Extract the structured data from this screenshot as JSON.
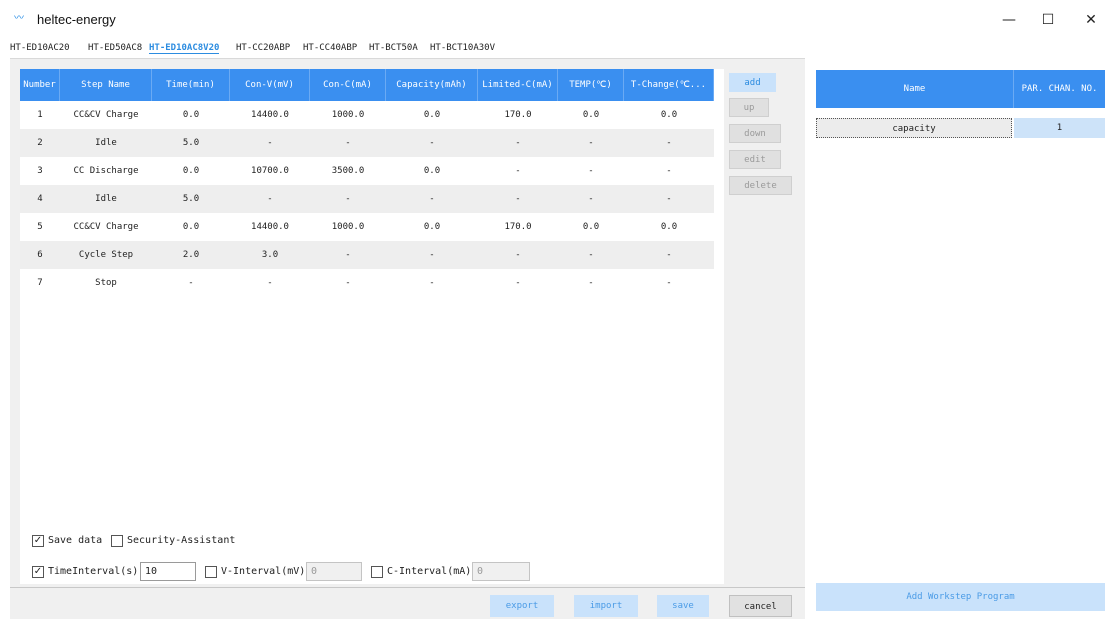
{
  "window": {
    "title": "heltec-energy",
    "minimize": "—",
    "maximize": "☐",
    "close": "✕"
  },
  "tabs": [
    {
      "label": "HT-ED10AC20"
    },
    {
      "label": "HT-ED50AC8"
    },
    {
      "label": "HT-ED10AC8V20",
      "active": true
    },
    {
      "label": "HT-CC20ABP"
    },
    {
      "label": "HT-CC40ABP"
    },
    {
      "label": "HT-BCT50A"
    },
    {
      "label": "HT-BCT10A30V"
    }
  ],
  "table": {
    "headers": [
      "Number",
      "Step Name",
      "Time(min)",
      "Con-V(mV)",
      "Con-C(mA)",
      "Capacity(mAh)",
      "Limited-C(mA)",
      "TEMP(℃)",
      "T-Change(℃..."
    ],
    "rows": [
      [
        "1",
        "CC&CV Charge",
        "0.0",
        "14400.0",
        "1000.0",
        "0.0",
        "170.0",
        "0.0",
        "0.0"
      ],
      [
        "2",
        "Idle",
        "5.0",
        "-",
        "-",
        "-",
        "-",
        "-",
        "-"
      ],
      [
        "3",
        "CC Discharge",
        "0.0",
        "10700.0",
        "3500.0",
        "0.0",
        "-",
        "-",
        "-"
      ],
      [
        "4",
        "Idle",
        "5.0",
        "-",
        "-",
        "-",
        "-",
        "-",
        "-"
      ],
      [
        "5",
        "CC&CV Charge",
        "0.0",
        "14400.0",
        "1000.0",
        "0.0",
        "170.0",
        "0.0",
        "0.0"
      ],
      [
        "6",
        "Cycle Step",
        "2.0",
        "3.0",
        "-",
        "-",
        "-",
        "-",
        "-"
      ],
      [
        "7",
        "Stop",
        "-",
        "-",
        "-",
        "-",
        "-",
        "-",
        "-"
      ]
    ]
  },
  "side_buttons": {
    "add": "add",
    "up": "up",
    "down": "down",
    "edit": "edit",
    "delete": "delete"
  },
  "options": {
    "save_data": {
      "label": "Save data",
      "checked": true
    },
    "security_assistant": {
      "label": "Security-Assistant",
      "checked": false
    },
    "time_interval": {
      "label": "TimeInterval(s)",
      "checked": true,
      "value": "10"
    },
    "v_interval": {
      "label": "V-Interval(mV)",
      "checked": false,
      "value": "0"
    },
    "c_interval": {
      "label": "C-Interval(mA)",
      "checked": false,
      "value": "0"
    }
  },
  "actions": {
    "export": "export",
    "import": "import",
    "save": "save",
    "cancel": "cancel"
  },
  "right_panel": {
    "headers": {
      "name": "Name",
      "par_chan_no": "PAR. CHAN. NO."
    },
    "rows": [
      {
        "name": "capacity",
        "par_chan_no": "1"
      }
    ],
    "add_program": "Add Workstep Program"
  },
  "icons": {
    "app": "app-logo-icon",
    "checkbox": "checkmark-icon"
  },
  "colors": {
    "header_blue": "#3a8ff0",
    "light_blue": "#c9e2fb",
    "active_tab": "#2c8ce0"
  }
}
